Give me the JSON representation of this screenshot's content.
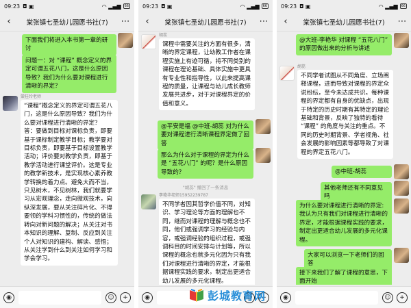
{
  "status": {
    "time": "09:23",
    "battery": "66"
  },
  "chat_title": "棠张镇七圣幼儿园愿书社(7)",
  "panels": [
    {
      "messages": [
        {
          "text": "下面我们将进入本书第一章的研讨"
        },
        {
          "text": "问题一：对 “课程” 概念定义的界定可谓五花八门，这是什么原因导致？我们为什么要对课程进行清晰的界定？"
        },
        {
          "sender": "棠桂玲老师",
          "text": "“课程”概念定义的界定可谓五花八门，这是什么原因导致？我们为什么要对课程进行清晰的界定？\n答：要做到目标对课标负责，即要基于课标制定教学目标；教学要对目标负责，即要基于目标设置教学活动；评价要对教学负责，即基于教学活动进行课堂评价。这是专业的教学新技术，是实现核心素养教学转换的着力点。避免大而不当，只见树木，不见树林，我们就要学习从宏观理念，走向微观技术，向纵深发展，要从关注碎片化、不得要领的学科习惯性的，传统的做法转向对新问题的解决；从关注对书本知识的理解、复制、反应到关注个人对知识的建构、解读、感悟；从关注学到什么到关注如何学习和学会学习。"
        }
      ]
    },
    {
      "messages": [
        {
          "sender": "胡蕊",
          "text": "课程中需要关注的方面有很多，清晰的界定课程，让幼教工作者在课程实施上有迹可循，将不同类别的课程在理论基础、具体实施中更具有专业性和指导性，以此来提高课程的质量，让课程与幼儿成长教师发展共进步，对于对课程界定的价值和意义。"
        },
        {
          "text": "@平安是福 @中班-胡蕊 对为什么要对课程进行清晰课程界定做了回答"
        },
        {
          "text": "那么为什么对于课程的界定为什么是 “五花八门” 的呢？是什么原因导致的？"
        },
        {
          "note": "\"胡蕊\" 撤回了一条消息"
        },
        {
          "sender": "李艳华老师15952239787",
          "text": "不同学者因其哲学价值不同，对知识、学习理论等方面的理解也不同，继而对课程的理解与概念也不同，他们或强调学习的经验与内容，或强调经验的组织过程，或强调科目的时间安排与计划等，所以课程的概念也就多元化因为只有我们对课程进行清晰的界定，才能根据课程实践的要求，制定出更适合幼儿发展的多元化课程。"
        }
      ]
    },
    {
      "messages": [
        {
          "text": "@大班-李艳华 对课程 “五花八门” 的原因做出来的分析与讲述"
        },
        {
          "sender": "胡蕊",
          "text": "不同学者试图从不同角度、立场阐释课程，进而导致对课程的界定众说纷纭，至今未达成共识。每种课程的界定都有自身的优缺点，出现于特定的历史时期有其特定的理论基础和背景，反映了独特的看待 “课程” 的角度与关注的重点。不同的历史时期背景、学者视角、社会发展的影响因素等都导致了对课程的界定五花八门。"
        },
        {
          "text": "@中班-胡蕊"
        },
        {
          "text": "其他老师还有不同意见吗"
        },
        {
          "text": "为什么要对课程进行清晰的界定:我认为只有我们对课程进行清晰的界定，才能根据课程实践的要求，制定出更适合幼儿发展的多元化课程。"
        },
        {
          "text": "大家可以浏览一下老师们的回答"
        },
        {
          "text": "接下来我们了解了课程的意思，下面开始"
        }
      ]
    }
  ],
  "watermark": "彭城教育网"
}
